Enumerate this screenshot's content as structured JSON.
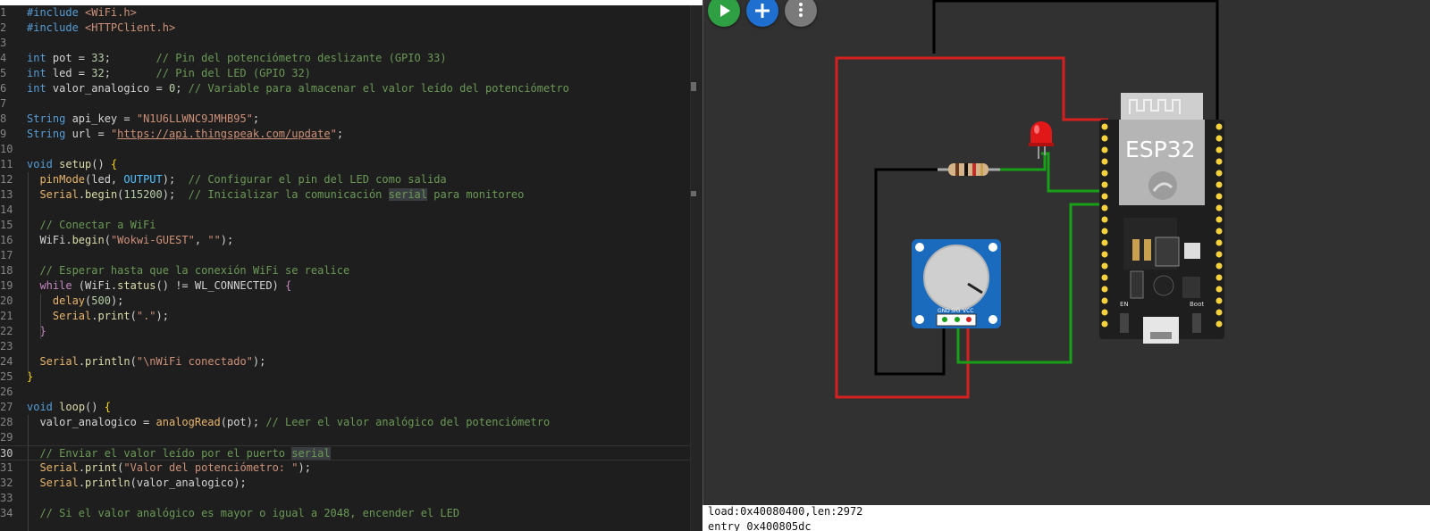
{
  "editor": {
    "lines": [
      {
        "n": "1",
        "segs": [
          [
            "#include ",
            "pre"
          ],
          [
            "<WiFi.h>",
            "inc"
          ]
        ]
      },
      {
        "n": "2",
        "segs": [
          [
            "#include ",
            "pre"
          ],
          [
            "<HTTPClient.h>",
            "inc"
          ]
        ]
      },
      {
        "n": "3",
        "segs": []
      },
      {
        "n": "4",
        "segs": [
          [
            "int",
            "kw"
          ],
          [
            " pot = ",
            ""
          ],
          [
            "33",
            "num"
          ],
          [
            ";       ",
            ""
          ],
          [
            "// Pin del potenciómetro deslizante (GPIO 33)",
            "cm"
          ]
        ]
      },
      {
        "n": "5",
        "segs": [
          [
            "int",
            "kw"
          ],
          [
            " led = ",
            ""
          ],
          [
            "32",
            "num"
          ],
          [
            ";       ",
            ""
          ],
          [
            "// Pin del LED (GPIO 32)",
            "cm"
          ]
        ]
      },
      {
        "n": "6",
        "segs": [
          [
            "int",
            "kw"
          ],
          [
            " valor_analogico = ",
            ""
          ],
          [
            "0",
            "num"
          ],
          [
            "; ",
            ""
          ],
          [
            "// Variable para almacenar el valor leído del potenciómetro",
            "cm"
          ]
        ]
      },
      {
        "n": "7",
        "segs": []
      },
      {
        "n": "8",
        "segs": [
          [
            "String",
            "kw"
          ],
          [
            " api_key = ",
            ""
          ],
          [
            "\"N1U6LLWNC9JMHB95\"",
            "str"
          ],
          [
            ";",
            ""
          ]
        ]
      },
      {
        "n": "9",
        "segs": [
          [
            "String",
            "kw"
          ],
          [
            " url = ",
            ""
          ],
          [
            "\"",
            "str"
          ],
          [
            "https://api.thingspeak.com/update",
            "str url"
          ],
          [
            "\"",
            "str"
          ],
          [
            ";",
            ""
          ]
        ]
      },
      {
        "n": "10",
        "segs": []
      },
      {
        "n": "11",
        "segs": [
          [
            "void",
            "kw"
          ],
          [
            " ",
            ""
          ],
          [
            "setup",
            "fn"
          ],
          [
            "() ",
            ""
          ],
          [
            "{",
            "br"
          ]
        ]
      },
      {
        "n": "12",
        "segs": [
          [
            "  ",
            ""
          ],
          [
            "pinMode",
            "ser"
          ],
          [
            "(led, ",
            ""
          ],
          [
            "OUTPUT",
            "const"
          ],
          [
            ");  ",
            ""
          ],
          [
            "// Configurar el pin del LED como salida",
            "cm"
          ]
        ]
      },
      {
        "n": "13",
        "segs": [
          [
            "  ",
            ""
          ],
          [
            "Serial",
            "ser"
          ],
          [
            ".",
            ""
          ],
          [
            "begin",
            "fn"
          ],
          [
            "(",
            ""
          ],
          [
            "115200",
            "num"
          ],
          [
            ");  ",
            ""
          ],
          [
            "// Inicializar la comunicación ",
            "cm"
          ],
          [
            "serial",
            "cm hl"
          ],
          [
            " para monitoreo",
            "cm"
          ]
        ]
      },
      {
        "n": "14",
        "segs": []
      },
      {
        "n": "15",
        "segs": [
          [
            "  ",
            ""
          ],
          [
            "// Conectar a WiFi",
            "cm"
          ]
        ]
      },
      {
        "n": "16",
        "segs": [
          [
            "  WiFi.",
            ""
          ],
          [
            "begin",
            "fn"
          ],
          [
            "(",
            ""
          ],
          [
            "\"Wokwi-GUEST\"",
            "str"
          ],
          [
            ", ",
            ""
          ],
          [
            "\"\"",
            "str"
          ],
          [
            ");",
            ""
          ]
        ]
      },
      {
        "n": "17",
        "segs": []
      },
      {
        "n": "18",
        "segs": [
          [
            "  ",
            ""
          ],
          [
            "// Esperar hasta que la conexión WiFi se realice",
            "cm"
          ]
        ]
      },
      {
        "n": "19",
        "segs": [
          [
            "  ",
            ""
          ],
          [
            "while",
            "ctl"
          ],
          [
            " (WiFi.",
            ""
          ],
          [
            "status",
            "fn"
          ],
          [
            "() != WL_CONNECTED) ",
            ""
          ],
          [
            "{",
            "ctl"
          ]
        ]
      },
      {
        "n": "20",
        "segs": [
          [
            "    ",
            ""
          ],
          [
            "delay",
            "ser"
          ],
          [
            "(",
            ""
          ],
          [
            "500",
            "num"
          ],
          [
            ");",
            ""
          ]
        ]
      },
      {
        "n": "21",
        "segs": [
          [
            "    ",
            ""
          ],
          [
            "Serial",
            "ser"
          ],
          [
            ".",
            ""
          ],
          [
            "print",
            "fn"
          ],
          [
            "(",
            ""
          ],
          [
            "\".\"",
            "str"
          ],
          [
            ");",
            ""
          ]
        ]
      },
      {
        "n": "22",
        "segs": [
          [
            "  ",
            ""
          ],
          [
            "}",
            "ctl"
          ]
        ]
      },
      {
        "n": "23",
        "segs": []
      },
      {
        "n": "24",
        "segs": [
          [
            "  ",
            ""
          ],
          [
            "Serial",
            "ser"
          ],
          [
            ".",
            ""
          ],
          [
            "println",
            "fn"
          ],
          [
            "(",
            ""
          ],
          [
            "\"\\nWiFi conectado\"",
            "str"
          ],
          [
            ");",
            ""
          ]
        ]
      },
      {
        "n": "25",
        "segs": [
          [
            "}",
            "br"
          ]
        ]
      },
      {
        "n": "26",
        "segs": []
      },
      {
        "n": "27",
        "segs": [
          [
            "void",
            "kw"
          ],
          [
            " ",
            ""
          ],
          [
            "loop",
            "fn"
          ],
          [
            "() ",
            ""
          ],
          [
            "{",
            "br"
          ]
        ]
      },
      {
        "n": "28",
        "segs": [
          [
            "  valor_analogico = ",
            ""
          ],
          [
            "analogRead",
            "ser"
          ],
          [
            "(pot); ",
            ""
          ],
          [
            "// Leer el valor analógico del potenciómetro",
            "cm"
          ]
        ]
      },
      {
        "n": "29",
        "segs": []
      },
      {
        "n": "30",
        "segs": [
          [
            "  ",
            ""
          ],
          [
            "// Enviar el valor leído por el puerto ",
            "cm"
          ],
          [
            "serial",
            "cm hl"
          ]
        ]
      },
      {
        "n": "31",
        "segs": [
          [
            "  ",
            ""
          ],
          [
            "Serial",
            "ser"
          ],
          [
            ".",
            ""
          ],
          [
            "print",
            "fn"
          ],
          [
            "(",
            ""
          ],
          [
            "\"Valor del potenciómetro: \"",
            "str"
          ],
          [
            ");",
            ""
          ]
        ]
      },
      {
        "n": "32",
        "segs": [
          [
            "  ",
            ""
          ],
          [
            "Serial",
            "ser"
          ],
          [
            ".",
            ""
          ],
          [
            "println",
            "fn"
          ],
          [
            "(valor_analogico);",
            ""
          ]
        ]
      },
      {
        "n": "33",
        "segs": []
      },
      {
        "n": "34",
        "segs": [
          [
            "  ",
            ""
          ],
          [
            "// Si el valor analógico es mayor o igual a 2048, encender el LED",
            "cm"
          ]
        ]
      }
    ],
    "current_line": "30"
  },
  "simulator": {
    "board_label": "ESP32",
    "pot_pins": [
      "GND",
      "SIG",
      "VCC"
    ],
    "en_label": "EN",
    "boot_label": "Boot",
    "colors": {
      "play": "#2ea043",
      "add": "#1f6fd1",
      "more": "#7a7a7a",
      "wire_red": "#d62020",
      "wire_green": "#19a019",
      "wire_black": "#000000"
    }
  },
  "serial_monitor": {
    "lines": [
      "load:0x40080400,len:2972",
      "entry 0x400805dc"
    ]
  }
}
